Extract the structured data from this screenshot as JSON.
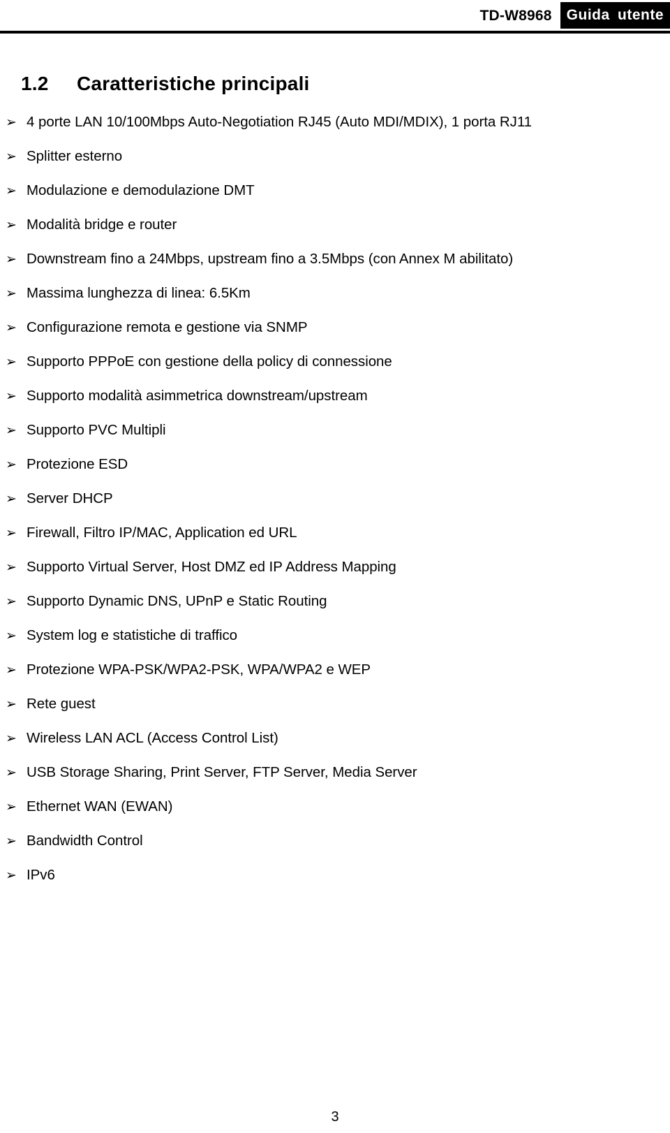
{
  "header": {
    "model": "TD-W8968",
    "guide_label": "Guida utente"
  },
  "section": {
    "number": "1.2",
    "title": "Caratteristiche principali"
  },
  "bullet_glyph": "➢",
  "features": [
    "4 porte LAN 10/100Mbps Auto-Negotiation RJ45 (Auto MDI/MDIX), 1 porta RJ11",
    "Splitter esterno",
    "Modulazione e demodulazione DMT",
    "Modalità bridge e router",
    "Downstream fino a 24Mbps, upstream fino a 3.5Mbps (con Annex M abilitato)",
    "Massima lunghezza di linea: 6.5Km",
    "Configurazione remota e gestione via SNMP",
    "Supporto PPPoE con gestione della policy di connessione",
    "Supporto modalità asimmetrica downstream/upstream",
    "Supporto PVC Multipli",
    "Protezione ESD",
    "Server DHCP",
    "Firewall, Filtro IP/MAC, Application ed URL",
    "Supporto Virtual Server, Host DMZ ed IP Address Mapping",
    "Supporto Dynamic DNS, UPnP e Static Routing",
    "System log e statistiche di traffico",
    "Protezione WPA-PSK/WPA2-PSK, WPA/WPA2 e WEP",
    "Rete guest",
    "Wireless LAN ACL (Access Control List)",
    "USB Storage Sharing, Print Server, FTP Server, Media Server",
    "Ethernet WAN (EWAN)",
    "Bandwidth Control",
    "IPv6"
  ],
  "footer": {
    "page_number": "3"
  },
  "colors": {
    "text": "#000000",
    "background": "#ffffff",
    "header_box_background": "#000000",
    "header_box_text": "#ffffff"
  }
}
